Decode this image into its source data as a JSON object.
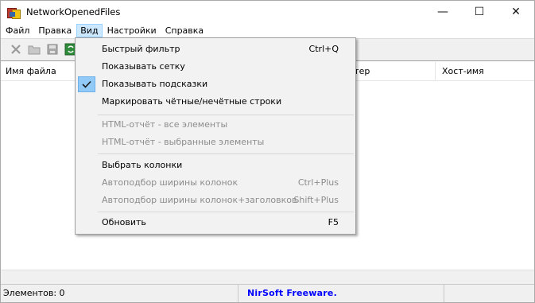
{
  "window": {
    "title": "NetworkOpenedFiles",
    "minimize_glyph": "—",
    "maximize_glyph": "☐",
    "close_glyph": "✕"
  },
  "menubar": {
    "items": [
      "Файл",
      "Правка",
      "Вид",
      "Настройки",
      "Справка"
    ],
    "active_index": 2
  },
  "toolbar": {
    "icons": [
      "delete-icon",
      "open-folder-icon",
      "save-icon",
      "refresh-icon"
    ]
  },
  "columns": [
    "Имя файла",
    "ютер",
    "Хост-имя"
  ],
  "view_menu": {
    "items": [
      {
        "label": "Быстрый фильтр",
        "shortcut": "Ctrl+Q",
        "enabled": true,
        "checked": false
      },
      {
        "label": "Показывать сетку",
        "shortcut": "",
        "enabled": true,
        "checked": false
      },
      {
        "label": "Показывать подсказки",
        "shortcut": "",
        "enabled": true,
        "checked": true
      },
      {
        "label": "Маркировать чётные/нечётные строки",
        "shortcut": "",
        "enabled": true,
        "checked": false
      },
      {
        "label": "HTML-отчёт - все элементы",
        "shortcut": "",
        "enabled": false,
        "checked": false
      },
      {
        "label": "HTML-отчёт - выбранные элементы",
        "shortcut": "",
        "enabled": false,
        "checked": false
      },
      {
        "label": "Выбрать колонки",
        "shortcut": "",
        "enabled": true,
        "checked": false
      },
      {
        "label": "Автоподбор ширины колонок",
        "shortcut": "Ctrl+Plus",
        "enabled": false,
        "checked": false
      },
      {
        "label": "Автоподбор ширины колонок+заголовков",
        "shortcut": "Shift+Plus",
        "enabled": false,
        "checked": false
      },
      {
        "label": "Обновить",
        "shortcut": "F5",
        "enabled": true,
        "checked": false
      }
    ]
  },
  "statusbar": {
    "count_text": "Элементов: 0",
    "credit_text": "NirSoft Freeware.  http://www.nirsoft.net"
  },
  "colors": {
    "menu_highlight": "#cce8ff",
    "check_highlight": "#91c9f7",
    "link": "#0000ff",
    "disabled_text": "#8c8c8c"
  }
}
